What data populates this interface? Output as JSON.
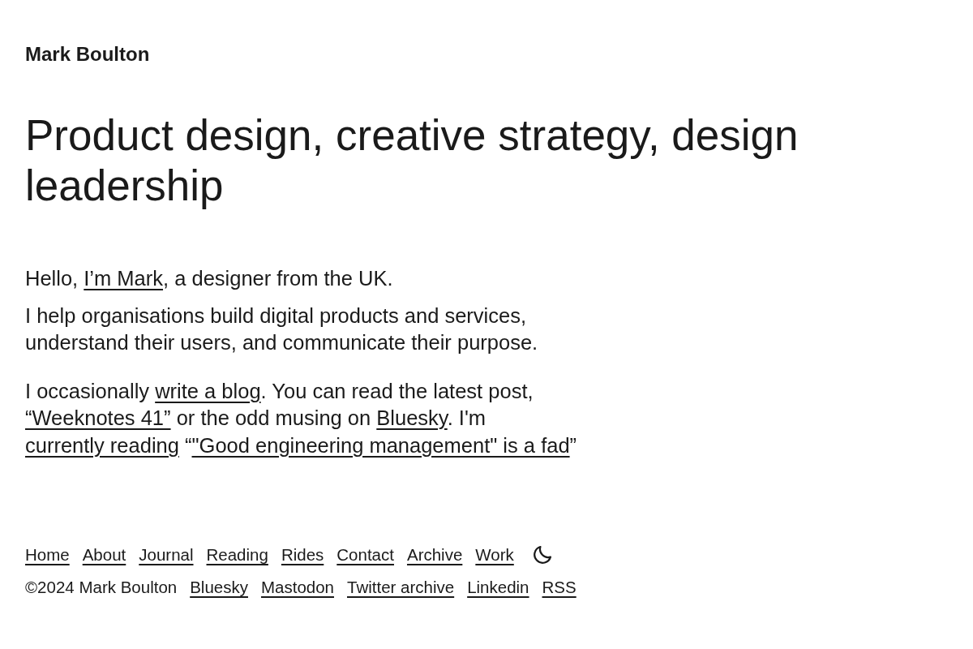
{
  "site_title": "Mark Boulton",
  "headline": "Product design, creative strategy, design leadership",
  "intro": [
    {
      "segments": [
        {
          "kind": "text",
          "text": "Hello, "
        },
        {
          "kind": "link",
          "text": "I’m Mark"
        },
        {
          "kind": "text",
          "text": ", a designer from the UK."
        }
      ]
    },
    {
      "segments": [
        {
          "kind": "text",
          "text": "I help organisations build digital products and services, understand their users, and communicate their purpose."
        }
      ]
    },
    {
      "segments": [
        {
          "kind": "text",
          "text": "I occasionally "
        },
        {
          "kind": "link",
          "text": "write a blog"
        },
        {
          "kind": "text",
          "text": ". You can read the latest post, "
        },
        {
          "kind": "link",
          "text": "“Weeknotes 41”"
        },
        {
          "kind": "text",
          "text": " or the odd musing on "
        },
        {
          "kind": "link",
          "text": "Bluesky"
        },
        {
          "kind": "text",
          "text": ". I'm "
        },
        {
          "kind": "link",
          "text": "currently reading"
        },
        {
          "kind": "text",
          "text": " “"
        },
        {
          "kind": "link",
          "text": "\"Good engineering management\" is a fad"
        },
        {
          "kind": "text",
          "text": "”"
        }
      ]
    }
  ],
  "nav": {
    "links": [
      "Home",
      "About",
      "Journal",
      "Reading",
      "Rides",
      "Contact",
      "Archive",
      "Work"
    ]
  },
  "footer": {
    "copyright": "©2024 Mark Boulton",
    "links": [
      "Bluesky",
      "Mastodon",
      "Twitter archive",
      "Linkedin",
      "RSS"
    ]
  }
}
